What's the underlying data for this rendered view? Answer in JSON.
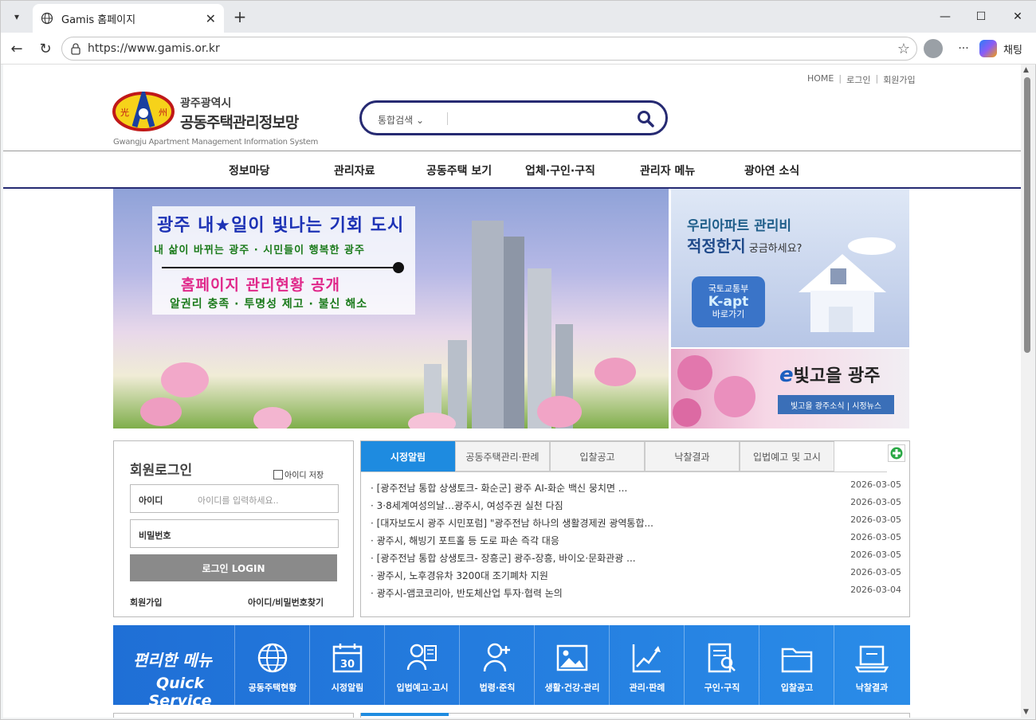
{
  "browser": {
    "tab_title": "Gamis 홈페이지",
    "url": "https://www.gamis.or.kr",
    "chat_label": "채팅"
  },
  "page": {
    "top_links": [
      "HOME",
      "로그인",
      "회원가입"
    ],
    "logo": {
      "city": "광주광역시",
      "name": "공동주택관리정보망",
      "english": "Gwangju Apartment Management Information System"
    },
    "search": {
      "category": "통합검색"
    },
    "gnb": [
      "정보마당",
      "관리자료",
      "공동주택 보기",
      "업체·구인·구직",
      "관리자 메뉴",
      "광아연 소식"
    ],
    "main_banner": {
      "line1": "광주 내★일이 빛나는 기회 도시",
      "line2": "내 삶이 바뀌는 광주 · 시민들이 행복한 광주",
      "line3": "홈페이지 관리현황 공개",
      "line4": "알권리 충족 · 투명성 제고 · 불신 해소"
    },
    "kapt_banner": {
      "line1": "우리아파트 관리비",
      "line2_bold": "적정한지",
      "line2_rest": " 궁금하세요?",
      "btn_line1": "국토교통부",
      "btn_line2": "K-apt",
      "btn_line3": "바로가기"
    },
    "e_banner": {
      "e": "e",
      "title": "빛고을 광주",
      "button": "빛고을 광주소식 | 시정뉴스"
    },
    "login": {
      "title": "회원로그인",
      "save_id": "아이디 저장",
      "id_label": "아이디",
      "id_placeholder": "아이디를 입력하세요..",
      "pw_label": "비밀번호",
      "button": "로그인 LOGIN",
      "join": "회원가입",
      "find": "아이디/비밀번호찾기"
    },
    "news": {
      "tabs": [
        "시정알림",
        "공동주택관리·판례",
        "입찰공고",
        "낙찰결과",
        "입법예고 및 고시"
      ],
      "items": [
        {
          "title": "[광주전남 통합 상생토크- 화순군] 광주 AI-화순 백신 뭉치면 ...",
          "date": "2026-03-05"
        },
        {
          "title": "3·8세계여성의날…광주시, 여성주권 실천 다짐",
          "date": "2026-03-05"
        },
        {
          "title": "[대자보도시 광주 시민포럼] \"광주전남 하나의 생활경제권 광역통합...",
          "date": "2026-03-05"
        },
        {
          "title": "광주시, 해빙기 포트홀 등 도로 파손 즉각 대응",
          "date": "2026-03-05"
        },
        {
          "title": "[광주전남 통합 상생토크- 장흥군] 광주-장흥, 바이오·문화관광 ...",
          "date": "2026-03-05"
        },
        {
          "title": "광주시, 노후경유차 3200대 조기폐차 지원",
          "date": "2026-03-05"
        },
        {
          "title": "광주시-앰코코리아, 반도체산업 투자·협력 논의",
          "date": "2026-03-04"
        }
      ]
    },
    "quick": {
      "title_kr": "편리한 메뉴",
      "title_en": "Quick Service",
      "items": [
        "공동주택현황",
        "시정알림",
        "입법예고·고시",
        "법령·준칙",
        "생활·건강·관리",
        "관리·판례",
        "구인·구직",
        "입찰공고",
        "낙찰결과"
      ]
    }
  }
}
